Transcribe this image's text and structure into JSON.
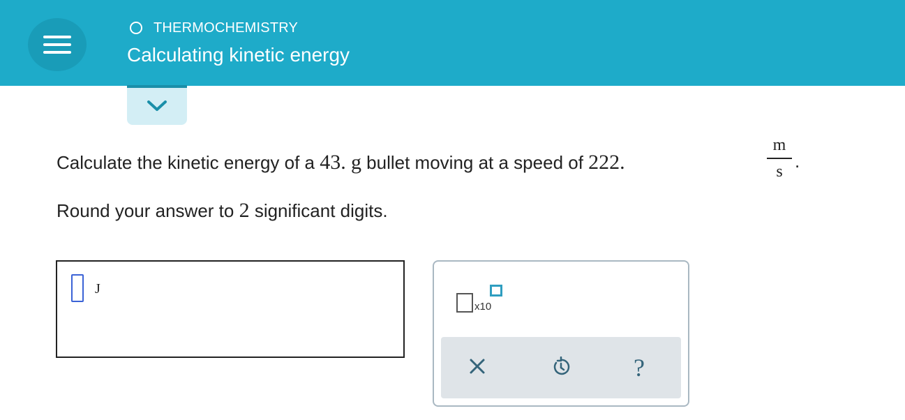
{
  "header": {
    "topic": "THERMOCHEMISTRY",
    "title": "Calculating kinetic energy",
    "menu_icon": "hamburger-icon",
    "background_color": "#1eabc9"
  },
  "expand_control": {
    "icon": "chevron-down-icon"
  },
  "question": {
    "text_before_mass": "Calculate the kinetic energy of a ",
    "mass_value": "43.",
    "mass_unit": "g",
    "text_before_speed": " bullet moving at a speed of ",
    "speed_value": "222.",
    "speed_unit_numerator": "m",
    "speed_unit_denominator": "s",
    "end_punctuation": ".",
    "instruction_before": "Round your answer to ",
    "sig_digits": "2",
    "instruction_after": " significant digits."
  },
  "answer": {
    "value": "",
    "unit": "J"
  },
  "tools": {
    "scientific_notation_label": "x10",
    "clear_icon": "x-icon",
    "undo_icon": "undo-icon",
    "help_glyph": "?",
    "accent_color": "#2f9ec0"
  }
}
